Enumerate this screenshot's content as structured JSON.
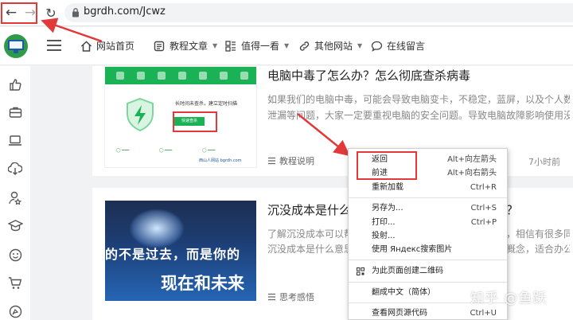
{
  "browser": {
    "url": "bgrdh.com/Jcwz",
    "back_icon": "←",
    "forward_icon": "→",
    "reload_icon": "↻"
  },
  "site_nav": {
    "items": [
      {
        "label": "网站首页",
        "icon": "home-icon",
        "has_caret": false
      },
      {
        "label": "教程文章",
        "icon": "document-icon",
        "has_caret": true
      },
      {
        "label": "值得一看",
        "icon": "grid-icon",
        "has_caret": true
      },
      {
        "label": "其他网站",
        "icon": "link-icon",
        "has_caret": true
      },
      {
        "label": "在线留言",
        "icon": "comment-icon",
        "has_caret": false
      }
    ],
    "caret": "▼"
  },
  "sidebar_icons": [
    "thumbs-up-icon",
    "briefcase-icon",
    "laptop-icon",
    "download-icon",
    "user-star-icon",
    "graduation-cap-icon",
    "smile-icon",
    "cart-icon",
    "settings-icon"
  ],
  "articles": [
    {
      "title": "电脑中毒了怎么办？怎么彻底查杀病毒",
      "excerpt_line1": "如果我们的电脑中毒，可能会导致电脑变卡，不稳定，蓝屏，以及个人数据的",
      "excerpt_line2": "泄漏等问题，大家一定要重视电脑的安全问题。导致电脑故障影响使用没有...",
      "category": "教程说明",
      "time": "7小时前",
      "thumb_text": "长时间未查杀，建立定时扫描",
      "thumb_button": "快速查杀",
      "thumb_brand": "西山人网站 bgrdh.com"
    },
    {
      "title": "沉没成本是什么意思？沉没成本的概念是什么？",
      "excerpt_line1": "了解沉没成本可以帮助我们在生活中避免一些错误的决策，相信有很多同学不知道",
      "excerpt_line2": "沉没成本是什么意思？今天就给大家介绍一下沉没成本的概念，适合办公人员...",
      "category": "思考感悟",
      "time": "",
      "thumb_line1": "的不是过去，而是你的",
      "thumb_line2": "现在和未来"
    }
  ],
  "context_menu": {
    "items": [
      {
        "label": "返回",
        "shortcut": "Alt+向左箭头"
      },
      {
        "label": "前进",
        "shortcut": "Alt+向右箭头"
      },
      {
        "label": "重新加载",
        "shortcut": "Ctrl+R"
      },
      {
        "label": "另存为...",
        "shortcut": "Ctrl+S"
      },
      {
        "label": "打印...",
        "shortcut": "Ctrl+P"
      },
      {
        "label": "投射...",
        "shortcut": ""
      },
      {
        "label": "使用 Яндекс搜索图片",
        "shortcut": ""
      },
      {
        "label": "为此页面创建二维码",
        "shortcut": ""
      },
      {
        "label": "翻成中文（简体）",
        "shortcut": ""
      },
      {
        "label": "查看网页源代码",
        "shortcut": "Ctrl+U"
      }
    ]
  },
  "watermark": "知乎 @鱼跃",
  "colors": {
    "accent_green": "#1bb155",
    "highlight_red": "#e23a3a",
    "site_green": "#2f9a47"
  }
}
